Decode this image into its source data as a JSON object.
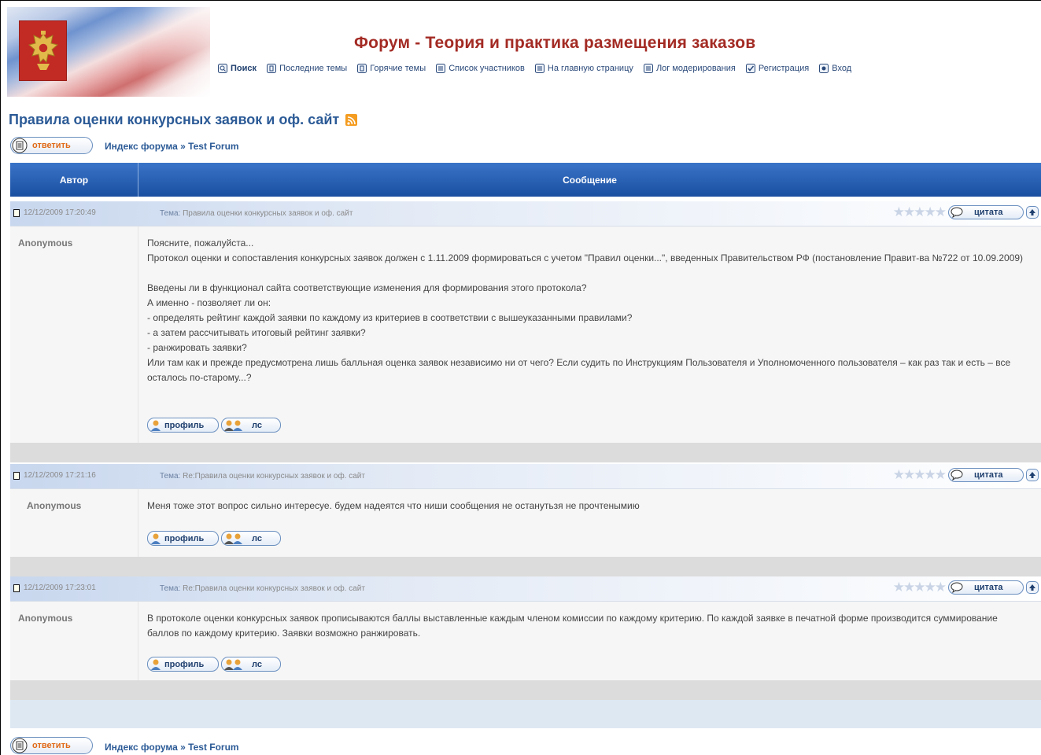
{
  "header": {
    "site_title": "Форум - Теория и практика размещения заказов",
    "nav": [
      {
        "label": "Поиск",
        "icon": "search-icon"
      },
      {
        "label": "Последние темы",
        "icon": "recent-topics-icon"
      },
      {
        "label": "Горячие темы",
        "icon": "hot-topics-icon"
      },
      {
        "label": "Список участников",
        "icon": "member-list-icon"
      },
      {
        "label": "На главную страницу",
        "icon": "home-page-icon"
      },
      {
        "label": "Лог модерирования",
        "icon": "moderation-log-icon"
      },
      {
        "label": "Регистрация",
        "icon": "register-icon"
      },
      {
        "label": "Вход",
        "icon": "login-icon"
      }
    ]
  },
  "topic": {
    "title": "Правила оценки конкурсных заявок и оф. сайт",
    "reply_label": "ответить",
    "breadcrumb_index": "Индекс форума",
    "breadcrumb_sep": "»",
    "breadcrumb_forum": "Test Forum"
  },
  "table": {
    "col_author": "Автор",
    "col_message": "Сообщение"
  },
  "labels": {
    "quote": "цитата",
    "profile": "профиль",
    "pm": "лс",
    "subject_prefix": "Тема:"
  },
  "posts": [
    {
      "date": "12/12/2009 17:20:49",
      "subject": "Правила оценки конкурсных заявок и оф. сайт",
      "author": "Anonymous",
      "lines": [
        "Поясните, пожалуйста...",
        "Протокол оценки и сопоставления конкурсных заявок должен с 1.11.2009 формироваться с учетом \"Правил оценки...\", введенных Правительством РФ (постановление Правит-ва №722 от 10.09.2009)",
        "",
        "Введены ли в функционал сайта соответствующие изменения для формирования этого протокола?",
        "А именно - позволяет ли он:",
        "- определять рейтинг каждой заявки по каждому из критериев в соответствии с вышеуказанными правилами?",
        "- а затем рассчитывать итоговый рейтинг заявки?",
        "- ранжировать заявки?",
        "Или там как и прежде предусмотрена лишь балльная оценка заявок независимо ни от чего? Если судить по Инструкциям Пользователя и Уполномоченного пользователя – как раз так и есть – все осталось по-старому...?"
      ]
    },
    {
      "date": "12/12/2009 17:21:16",
      "subject": "Re:Правила оценки конкурсных заявок и оф. сайт",
      "author": "Anonymous",
      "lines": [
        "Меня тоже этот вопрос сильно интересуе. будем надеятся что ниши сообщения не останутьзя не прочтенымию"
      ]
    },
    {
      "date": "12/12/2009 17:23:01",
      "subject": "Re:Правила оценки конкурсных заявок и оф. сайт",
      "author": "Anonymous",
      "lines": [
        "В протоколе оценки конкурсных заявок прописываются баллы выставленные каждым членом комиссии по каждому критерию. По каждой заявке в печатной форме производится суммирование баллов по каждому критерию. Заявки возможно ранжировать."
      ]
    }
  ]
}
